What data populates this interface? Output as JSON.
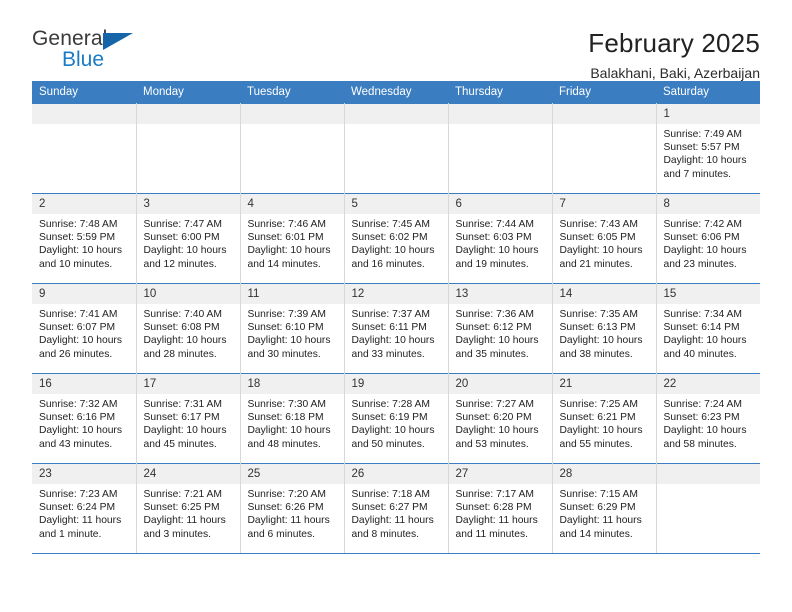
{
  "brand": {
    "name_part1": "General",
    "name_part2": "Blue",
    "accent_color": "#1a7bc4",
    "triangle_color": "#1565a8",
    "logo_icon": "triangle-icon"
  },
  "header": {
    "title": "February 2025",
    "subtitle": "Balakhani, Baki, Azerbaijan"
  },
  "calendar": {
    "header_bg": "#3a7dc0",
    "daynum_bg": "#f0f0f0",
    "weekdays": [
      "Sunday",
      "Monday",
      "Tuesday",
      "Wednesday",
      "Thursday",
      "Friday",
      "Saturday"
    ],
    "weeks": [
      [
        {
          "day": "",
          "lines": []
        },
        {
          "day": "",
          "lines": []
        },
        {
          "day": "",
          "lines": []
        },
        {
          "day": "",
          "lines": []
        },
        {
          "day": "",
          "lines": []
        },
        {
          "day": "",
          "lines": []
        },
        {
          "day": "1",
          "lines": [
            "Sunrise: 7:49 AM",
            "Sunset: 5:57 PM",
            "Daylight: 10 hours and 7 minutes."
          ]
        }
      ],
      [
        {
          "day": "2",
          "lines": [
            "Sunrise: 7:48 AM",
            "Sunset: 5:59 PM",
            "Daylight: 10 hours and 10 minutes."
          ]
        },
        {
          "day": "3",
          "lines": [
            "Sunrise: 7:47 AM",
            "Sunset: 6:00 PM",
            "Daylight: 10 hours and 12 minutes."
          ]
        },
        {
          "day": "4",
          "lines": [
            "Sunrise: 7:46 AM",
            "Sunset: 6:01 PM",
            "Daylight: 10 hours and 14 minutes."
          ]
        },
        {
          "day": "5",
          "lines": [
            "Sunrise: 7:45 AM",
            "Sunset: 6:02 PM",
            "Daylight: 10 hours and 16 minutes."
          ]
        },
        {
          "day": "6",
          "lines": [
            "Sunrise: 7:44 AM",
            "Sunset: 6:03 PM",
            "Daylight: 10 hours and 19 minutes."
          ]
        },
        {
          "day": "7",
          "lines": [
            "Sunrise: 7:43 AM",
            "Sunset: 6:05 PM",
            "Daylight: 10 hours and 21 minutes."
          ]
        },
        {
          "day": "8",
          "lines": [
            "Sunrise: 7:42 AM",
            "Sunset: 6:06 PM",
            "Daylight: 10 hours and 23 minutes."
          ]
        }
      ],
      [
        {
          "day": "9",
          "lines": [
            "Sunrise: 7:41 AM",
            "Sunset: 6:07 PM",
            "Daylight: 10 hours and 26 minutes."
          ]
        },
        {
          "day": "10",
          "lines": [
            "Sunrise: 7:40 AM",
            "Sunset: 6:08 PM",
            "Daylight: 10 hours and 28 minutes."
          ]
        },
        {
          "day": "11",
          "lines": [
            "Sunrise: 7:39 AM",
            "Sunset: 6:10 PM",
            "Daylight: 10 hours and 30 minutes."
          ]
        },
        {
          "day": "12",
          "lines": [
            "Sunrise: 7:37 AM",
            "Sunset: 6:11 PM",
            "Daylight: 10 hours and 33 minutes."
          ]
        },
        {
          "day": "13",
          "lines": [
            "Sunrise: 7:36 AM",
            "Sunset: 6:12 PM",
            "Daylight: 10 hours and 35 minutes."
          ]
        },
        {
          "day": "14",
          "lines": [
            "Sunrise: 7:35 AM",
            "Sunset: 6:13 PM",
            "Daylight: 10 hours and 38 minutes."
          ]
        },
        {
          "day": "15",
          "lines": [
            "Sunrise: 7:34 AM",
            "Sunset: 6:14 PM",
            "Daylight: 10 hours and 40 minutes."
          ]
        }
      ],
      [
        {
          "day": "16",
          "lines": [
            "Sunrise: 7:32 AM",
            "Sunset: 6:16 PM",
            "Daylight: 10 hours and 43 minutes."
          ]
        },
        {
          "day": "17",
          "lines": [
            "Sunrise: 7:31 AM",
            "Sunset: 6:17 PM",
            "Daylight: 10 hours and 45 minutes."
          ]
        },
        {
          "day": "18",
          "lines": [
            "Sunrise: 7:30 AM",
            "Sunset: 6:18 PM",
            "Daylight: 10 hours and 48 minutes."
          ]
        },
        {
          "day": "19",
          "lines": [
            "Sunrise: 7:28 AM",
            "Sunset: 6:19 PM",
            "Daylight: 10 hours and 50 minutes."
          ]
        },
        {
          "day": "20",
          "lines": [
            "Sunrise: 7:27 AM",
            "Sunset: 6:20 PM",
            "Daylight: 10 hours and 53 minutes."
          ]
        },
        {
          "day": "21",
          "lines": [
            "Sunrise: 7:25 AM",
            "Sunset: 6:21 PM",
            "Daylight: 10 hours and 55 minutes."
          ]
        },
        {
          "day": "22",
          "lines": [
            "Sunrise: 7:24 AM",
            "Sunset: 6:23 PM",
            "Daylight: 10 hours and 58 minutes."
          ]
        }
      ],
      [
        {
          "day": "23",
          "lines": [
            "Sunrise: 7:23 AM",
            "Sunset: 6:24 PM",
            "Daylight: 11 hours and 1 minute."
          ]
        },
        {
          "day": "24",
          "lines": [
            "Sunrise: 7:21 AM",
            "Sunset: 6:25 PM",
            "Daylight: 11 hours and 3 minutes."
          ]
        },
        {
          "day": "25",
          "lines": [
            "Sunrise: 7:20 AM",
            "Sunset: 6:26 PM",
            "Daylight: 11 hours and 6 minutes."
          ]
        },
        {
          "day": "26",
          "lines": [
            "Sunrise: 7:18 AM",
            "Sunset: 6:27 PM",
            "Daylight: 11 hours and 8 minutes."
          ]
        },
        {
          "day": "27",
          "lines": [
            "Sunrise: 7:17 AM",
            "Sunset: 6:28 PM",
            "Daylight: 11 hours and 11 minutes."
          ]
        },
        {
          "day": "28",
          "lines": [
            "Sunrise: 7:15 AM",
            "Sunset: 6:29 PM",
            "Daylight: 11 hours and 14 minutes."
          ]
        },
        {
          "day": "",
          "lines": []
        }
      ]
    ]
  }
}
